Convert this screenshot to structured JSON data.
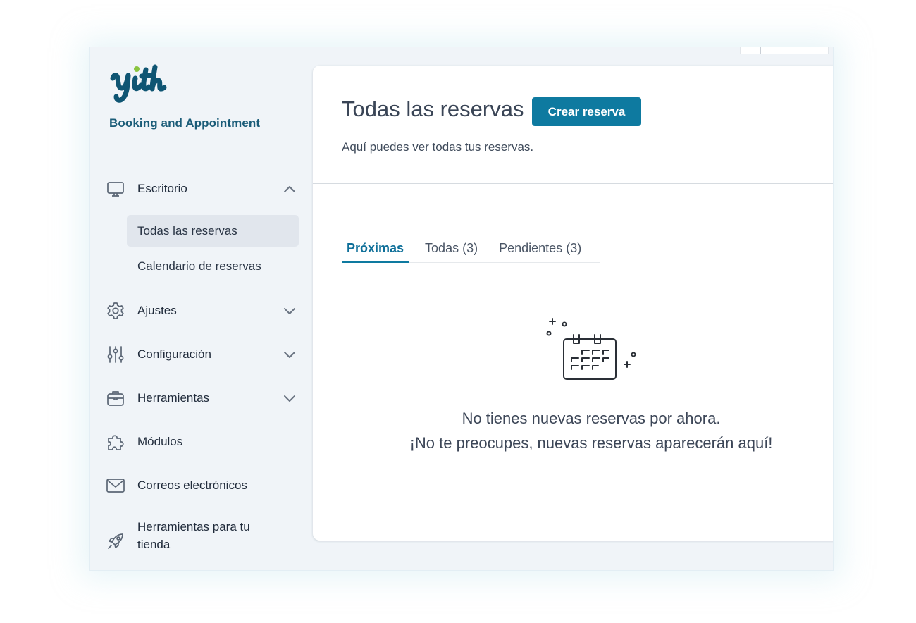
{
  "sidebar": {
    "brand": "Booking and Appointment",
    "menu": [
      {
        "label": "Escritorio",
        "icon": "monitor-icon",
        "expanded": true
      },
      {
        "label": "Ajustes",
        "icon": "gear-icon"
      },
      {
        "label": "Configuración",
        "icon": "sliders-icon"
      },
      {
        "label": "Herramientas",
        "icon": "briefcase-icon"
      },
      {
        "label": "Módulos",
        "icon": "puzzle-icon"
      },
      {
        "label": "Correos electrónicos",
        "icon": "envelope-icon"
      },
      {
        "label": "Herramientas para tu tienda",
        "icon": "rocket-icon"
      }
    ],
    "submenu": [
      {
        "label": "Todas las reservas",
        "active": true
      },
      {
        "label": "Calendario de reservas"
      }
    ]
  },
  "main": {
    "title": "Todas las reservas",
    "create_button": "Crear reserva",
    "description": "Aquí puedes ver todas tus reservas.",
    "tabs": [
      {
        "label": "Próximas",
        "active": true
      },
      {
        "label": "Todas",
        "count": "(3)"
      },
      {
        "label": "Pendientes",
        "count": "(3)"
      }
    ],
    "empty_line1": "No tienes nuevas reservas por ahora.",
    "empty_line2": "¡No te preocupes, nuevas reservas aparecerán aquí!"
  },
  "colors": {
    "accent": "#0e7aa0",
    "brand_text": "#1a5c78",
    "logo_dot": "#8ac43f",
    "sidebar_bg": "#f0f4f8"
  }
}
